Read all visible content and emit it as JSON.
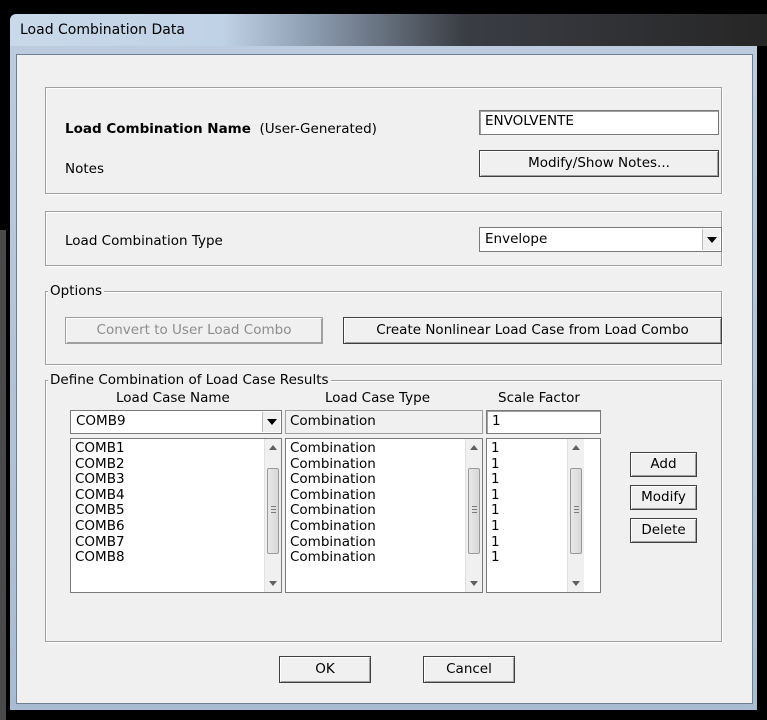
{
  "window": {
    "title": "Load Combination Data"
  },
  "name_section": {
    "name_label_bold": "Load Combination Name",
    "name_label_suffix": "(User-Generated)",
    "name_value": "ENVOLVENTE",
    "notes_label": "Notes",
    "notes_button": "Modify/Show Notes..."
  },
  "type_section": {
    "type_label": "Load Combination Type",
    "type_value": "Envelope"
  },
  "options": {
    "legend": "Options",
    "convert_button": "Convert to User Load Combo",
    "create_button": "Create Nonlinear Load Case from Load Combo"
  },
  "define": {
    "legend": "Define Combination of Load Case Results",
    "col_name": "Load Case Name",
    "col_type": "Load Case Type",
    "col_scale": "Scale Factor",
    "selected_name": "COMB9",
    "selected_type": "Combination",
    "selected_scale": "1",
    "rows": [
      {
        "name": "COMB1",
        "type": "Combination",
        "scale": "1"
      },
      {
        "name": "COMB2",
        "type": "Combination",
        "scale": "1"
      },
      {
        "name": "COMB3",
        "type": "Combination",
        "scale": "1"
      },
      {
        "name": "COMB4",
        "type": "Combination",
        "scale": "1"
      },
      {
        "name": "COMB5",
        "type": "Combination",
        "scale": "1"
      },
      {
        "name": "COMB6",
        "type": "Combination",
        "scale": "1"
      },
      {
        "name": "COMB7",
        "type": "Combination",
        "scale": "1"
      },
      {
        "name": "COMB8",
        "type": "Combination",
        "scale": "1"
      }
    ],
    "add_button": "Add",
    "modify_button": "Modify",
    "delete_button": "Delete"
  },
  "footer": {
    "ok_button": "OK",
    "cancel_button": "Cancel"
  }
}
